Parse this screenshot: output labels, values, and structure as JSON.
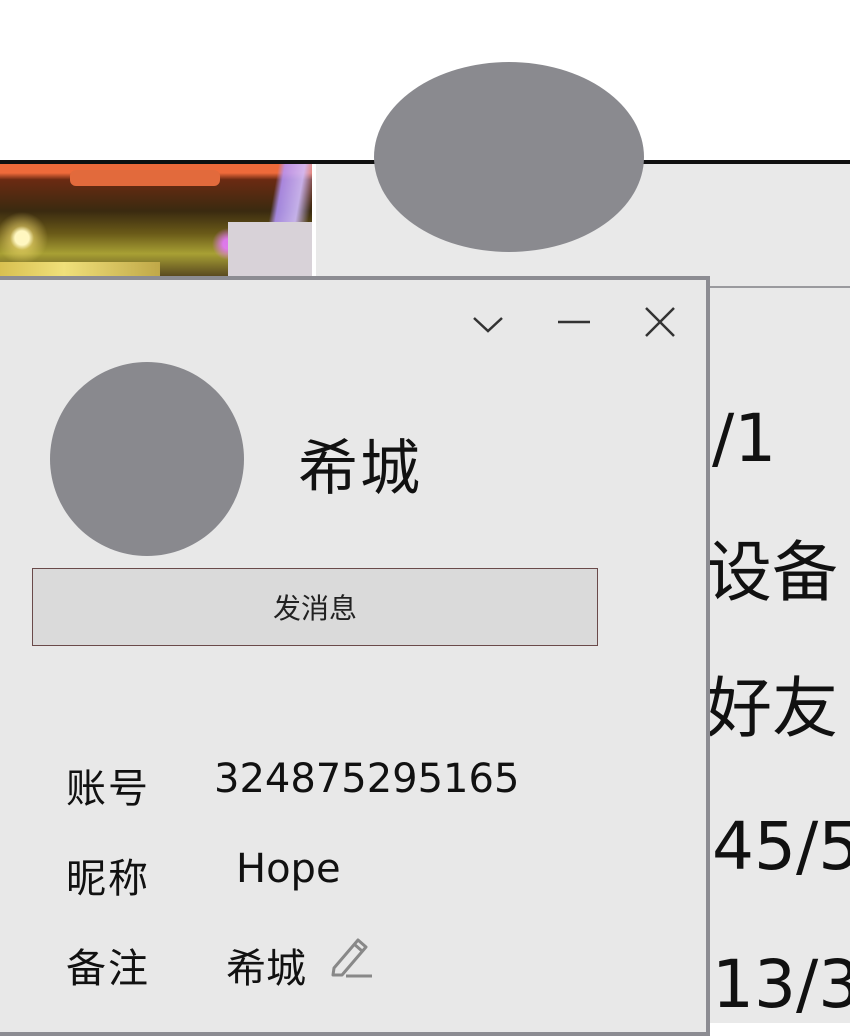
{
  "profile_window": {
    "controls": [
      "chevron-down-icon",
      "minimize-icon",
      "close-icon"
    ],
    "display_name": "希城",
    "message_button_label": "发消息",
    "fields": [
      {
        "label": "账号",
        "value": "324875295165"
      },
      {
        "label": "昵称",
        "value": "Hope"
      },
      {
        "label": "备注",
        "value": "希城"
      }
    ],
    "remark_edit_icon": "pencil-icon"
  },
  "background_panel": {
    "partial_texts": [
      "/1",
      "设备",
      "好友",
      "45/5",
      "13/3"
    ]
  },
  "colors": {
    "dialog_bg": "#e8e8e8",
    "avatar_gray": "#89898e",
    "border_gray": "#8c8c92",
    "button_bg": "#dadada"
  }
}
